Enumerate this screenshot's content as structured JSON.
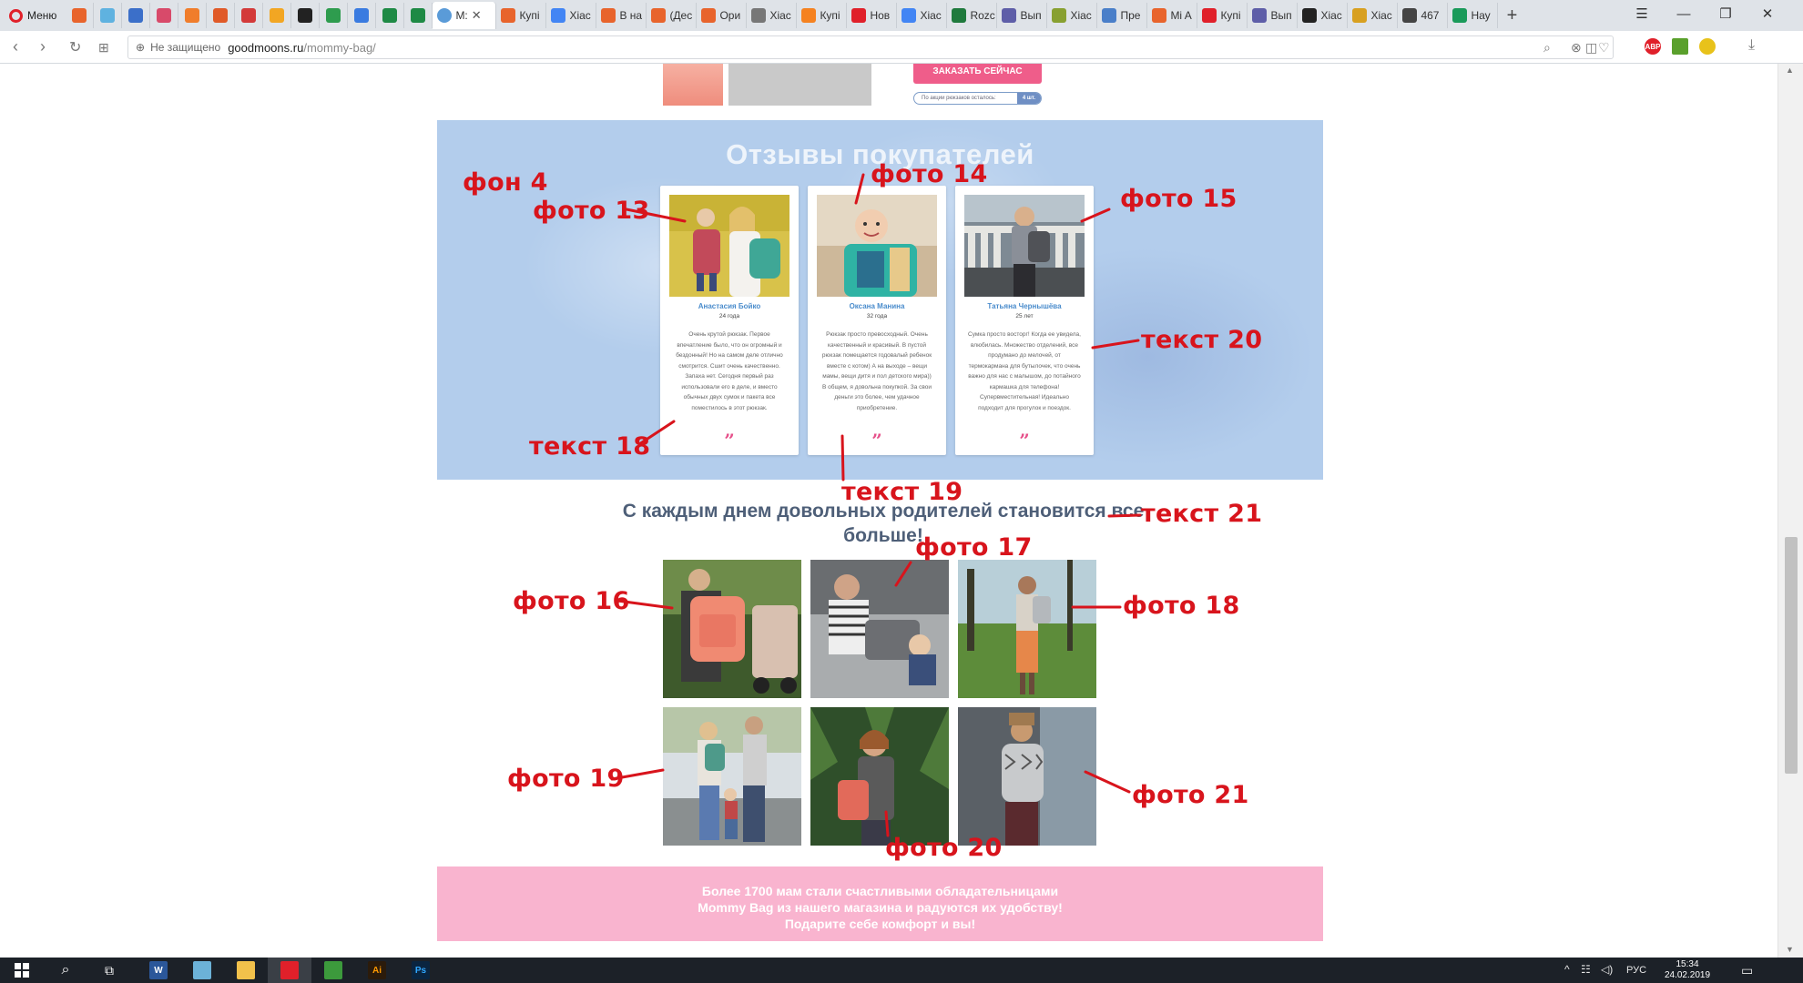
{
  "browser": {
    "menu_label": "Меню",
    "tabs": [
      {
        "label": "",
        "color": "#e8642c"
      },
      {
        "label": "",
        "color": "#5fb2e0"
      },
      {
        "label": "",
        "color": "#3b6fc9"
      },
      {
        "label": "",
        "color": "#d84a6a"
      },
      {
        "label": "",
        "color": "#f07d2b"
      },
      {
        "label": "",
        "color": "#e05a28"
      },
      {
        "label": "",
        "color": "#d33a3a"
      },
      {
        "label": "",
        "color": "#f2a623"
      },
      {
        "label": "",
        "color": "#222222"
      },
      {
        "label": "",
        "color": "#2e9c4e"
      },
      {
        "label": "",
        "color": "#3a7be0"
      },
      {
        "label": "",
        "color": "#1e8a45"
      },
      {
        "label": "",
        "color": "#1e8a45"
      }
    ],
    "active_tab": {
      "label": "M:",
      "color": "#5a9bd8"
    },
    "text_tabs": [
      {
        "label": "Купі",
        "color": "#e8642c"
      },
      {
        "label": "Xiac",
        "color": "#4285f4"
      },
      {
        "label": "В на",
        "color": "#e8642c"
      },
      {
        "label": "(Дес",
        "color": "#e8642c"
      },
      {
        "label": "Ори",
        "color": "#e8642c"
      },
      {
        "label": "Xiac",
        "color": "#777777"
      },
      {
        "label": "Купі",
        "color": "#f58220"
      },
      {
        "label": "Нов",
        "color": "#e0202a"
      },
      {
        "label": "Xiac",
        "color": "#4285f4"
      },
      {
        "label": "Rozc",
        "color": "#1f7a3d"
      },
      {
        "label": "Вып",
        "color": "#5e5ea8"
      },
      {
        "label": "Xiac",
        "color": "#88a030"
      },
      {
        "label": "Пре",
        "color": "#4a7fc9"
      },
      {
        "label": "Mi A",
        "color": "#e8642c"
      },
      {
        "label": "Купі",
        "color": "#e0202a"
      },
      {
        "label": "Вып",
        "color": "#5e5ea8"
      },
      {
        "label": "Xiac",
        "color": "#222222"
      },
      {
        "label": "Xiac",
        "color": "#d8a020"
      },
      {
        "label": "467",
        "color": "#444444"
      },
      {
        "label": "Нау",
        "color": "#1a9a5a"
      }
    ],
    "address": {
      "security": "Не защищено",
      "host": "goodmoons.ru",
      "path": "/mommy-bag/"
    },
    "extensions": [
      {
        "label": "ABP",
        "color": "#e0202a"
      }
    ]
  },
  "page": {
    "order_button": "ЗАКАЗАТЬ СЕЙЧАС",
    "stock": {
      "label": "По акции рюкзаков осталось:",
      "count": "4 шт."
    },
    "reviews": {
      "title": "Отзывы покупателей",
      "cards": [
        {
          "name": "Анастасия Бойко",
          "age": "24 года",
          "text": "Очень крутой рюкзак. Первое впечатление было, что он огромный и бездонный! Но на самом деле отлично смотрится. Сшит очень качественно. Запаха нет. Сегодня первый раз использовали его в деле, и вместо обычных двух сумок и пакета все поместилось в этот рюкзак.",
          "quote": "”"
        },
        {
          "name": "Оксана Манина",
          "age": "32 года",
          "text": "Рюкзак просто превосходный. Очень качественный и красивый. В пустой рюкзак помещается годовалый ребенок вместе с котом) А на выходе – вещи мамы, вещи дитя и пол детского мира)) В общем, я довольна покупкой. За свои деньги это более, чем удачное приобретение.",
          "quote": "”"
        },
        {
          "name": "Татьяна Чернышёва",
          "age": "25 лет",
          "text": "Сумка просто восторг! Когда ее увидела, влюбилась. Множество отделений, все продумано до мелочей, от термокармана для бутылочек, что очень важно для нас с малышом, до потайного кармашка для телефона! Супервместительная! Идеально подходит для прогулок и поездок.",
          "quote": "”"
        }
      ]
    },
    "happy_heading": "С каждым днем довольных родителей становится все больше!",
    "banner_lines": [
      "Более 1700 мам стали счастливыми обладательницами",
      "Mommy Bag из нашего магазина и радуются их удобству!",
      "Подарите себе комфорт и вы!"
    ]
  },
  "annotations": {
    "bg": "фон 4",
    "photo13": "фото 13",
    "photo14": "фото 14",
    "photo15": "фото 15",
    "text20": "текст 20",
    "text18": "текст 18",
    "text19": "текст 19",
    "text21": "текст 21",
    "photo16": "фото 16",
    "photo17": "фото 17",
    "photo18": "фото 18",
    "photo19": "фото 19",
    "photo20": "фото 20",
    "photo21": "фото 21"
  },
  "taskbar": {
    "lang": "РУС",
    "time": "15:34",
    "date": "24.02.2019",
    "apps": [
      {
        "label": "W",
        "color": "#2b579a"
      },
      {
        "label": "",
        "color": "#6cb2d8"
      },
      {
        "label": "",
        "color": "#f2c14b"
      },
      {
        "label": "",
        "color": "#e0202a"
      },
      {
        "label": "",
        "color": "#3c9a3c"
      },
      {
        "label": "Ai",
        "color": "#2b1b0b"
      },
      {
        "label": "Ps",
        "color": "#0a2540"
      }
    ]
  }
}
